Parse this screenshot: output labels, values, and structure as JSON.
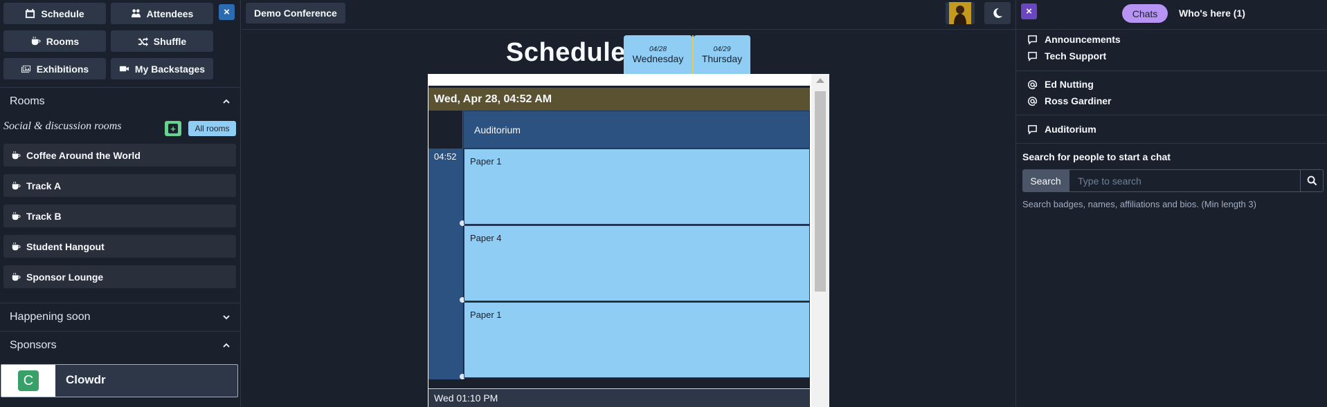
{
  "nav": {
    "schedule": "Schedule",
    "attendees": "Attendees",
    "rooms": "Rooms",
    "shuffle": "Shuffle",
    "exhibitions": "Exhibitions",
    "my_backstages": "My Backstages",
    "close_glyph": "×"
  },
  "rooms_section": {
    "title": "Rooms",
    "subtitle": "Social & discussion rooms",
    "add_glyph": "+",
    "all_rooms": "All rooms",
    "items": [
      {
        "label": "Coffee Around the World"
      },
      {
        "label": "Track A"
      },
      {
        "label": "Track B"
      },
      {
        "label": "Student Hangout"
      },
      {
        "label": "Sponsor Lounge"
      }
    ]
  },
  "happening_soon": {
    "title": "Happening soon"
  },
  "sponsors": {
    "title": "Sponsors",
    "items": [
      {
        "logo_letter": "C",
        "name": "Clowdr"
      }
    ]
  },
  "header": {
    "conference": "Demo Conference"
  },
  "schedule": {
    "title": "Schedule",
    "tabs": [
      {
        "date": "04/28",
        "day": "Wednesday"
      },
      {
        "date": "04/29",
        "day": "Thursday"
      }
    ],
    "banner": "Wed, Apr 28, 04:52 AM",
    "room": "Auditorium",
    "time_label": "04:52",
    "events": [
      {
        "title": "Paper 1"
      },
      {
        "title": "Paper 4"
      },
      {
        "title": "Paper 1"
      }
    ],
    "next_row": "Wed 01:10 PM"
  },
  "chat_panel": {
    "close_glyph": "×",
    "tabs": {
      "chats": "Chats",
      "whos_here": "Who's here (1)"
    },
    "channels": [
      {
        "label": "Announcements"
      },
      {
        "label": "Tech Support"
      }
    ],
    "dms": [
      {
        "label": "Ed Nutting"
      },
      {
        "label": "Ross Gardiner"
      }
    ],
    "room_chats": [
      {
        "label": "Auditorium"
      }
    ],
    "search_heading": "Search for people to start a chat",
    "search_button": "Search",
    "search_placeholder": "Type to search",
    "search_help": "Search badges, names, affiliations and bios. (Min length 3)"
  },
  "colors": {
    "background": "#1a202c",
    "accent_blue": "#2b6cb0",
    "accent_purple": "#6b46c1",
    "tab_light_blue": "#90cdf4",
    "room_head": "#2c5282",
    "chats_pill": "#b794f4"
  }
}
